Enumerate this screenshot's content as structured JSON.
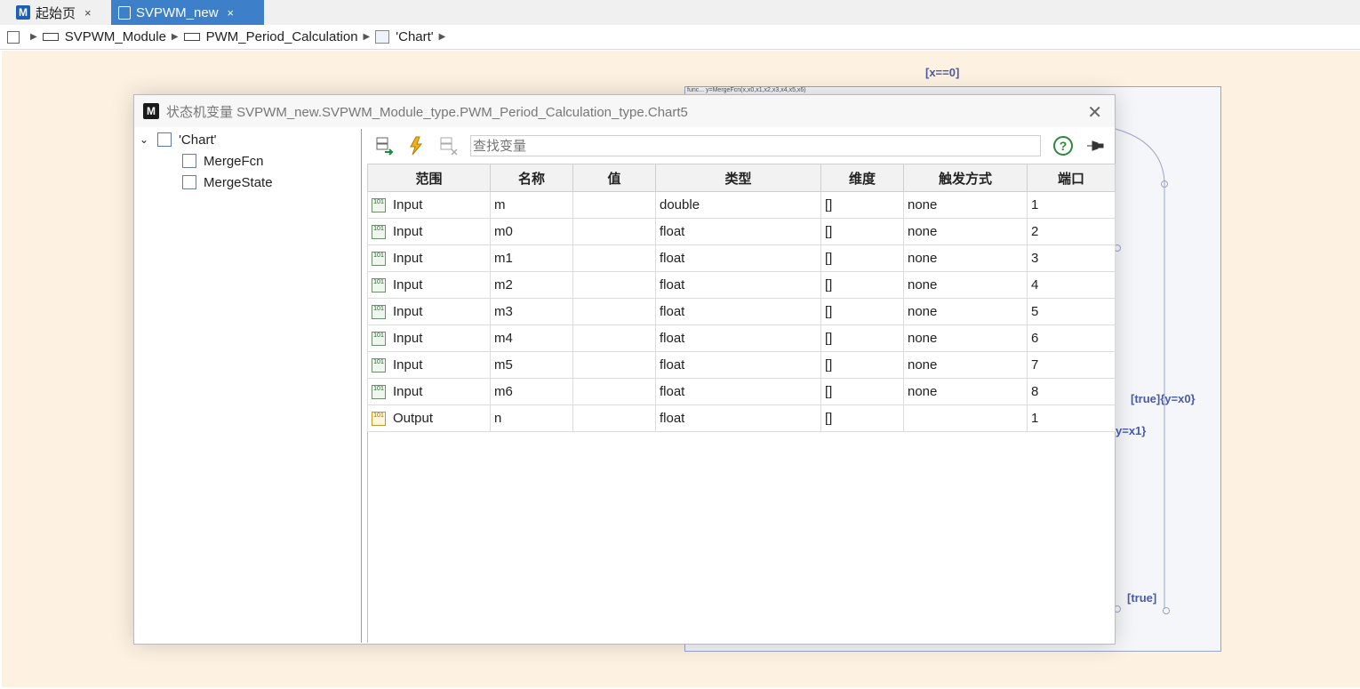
{
  "tabs": [
    {
      "label": "起始页",
      "close": "×"
    },
    {
      "label": "SVPWM_new",
      "close": "×"
    }
  ],
  "breadcrumb": [
    "SVPWM_Module",
    "PWM_Period_Calculation",
    "'Chart'"
  ],
  "canvas": {
    "label_top": "[x==0]",
    "label_state": "func... y=MergeFcn(x,x0,x1,x2,x3,x4,x5,x6)",
    "label_t1": "[true]{y=x0}",
    "label_t2": "y=x1}",
    "label_t3": "[true]"
  },
  "dialog": {
    "title": "状态机变量 SVPWM_new.SVPWM_Module_type.PWM_Period_Calculation_type.Chart5",
    "close": "✕",
    "tree": {
      "root": "'Chart'",
      "children": [
        "MergeFcn",
        "MergeState"
      ]
    },
    "search_placeholder": "查找变量",
    "help": "?",
    "columns": [
      "范围",
      "名称",
      "值",
      "类型",
      "维度",
      "触发方式",
      "端口"
    ],
    "rows": [
      {
        "scope": "Input",
        "name": "m",
        "value": "",
        "type": "double",
        "dim": "[]",
        "trigger": "none",
        "port": "1"
      },
      {
        "scope": "Input",
        "name": "m0",
        "value": "",
        "type": "float",
        "dim": "[]",
        "trigger": "none",
        "port": "2"
      },
      {
        "scope": "Input",
        "name": "m1",
        "value": "",
        "type": "float",
        "dim": "[]",
        "trigger": "none",
        "port": "3"
      },
      {
        "scope": "Input",
        "name": "m2",
        "value": "",
        "type": "float",
        "dim": "[]",
        "trigger": "none",
        "port": "4"
      },
      {
        "scope": "Input",
        "name": "m3",
        "value": "",
        "type": "float",
        "dim": "[]",
        "trigger": "none",
        "port": "5"
      },
      {
        "scope": "Input",
        "name": "m4",
        "value": "",
        "type": "float",
        "dim": "[]",
        "trigger": "none",
        "port": "6"
      },
      {
        "scope": "Input",
        "name": "m5",
        "value": "",
        "type": "float",
        "dim": "[]",
        "trigger": "none",
        "port": "7"
      },
      {
        "scope": "Input",
        "name": "m6",
        "value": "",
        "type": "float",
        "dim": "[]",
        "trigger": "none",
        "port": "8"
      },
      {
        "scope": "Output",
        "name": "n",
        "value": "",
        "type": "float",
        "dim": "[]",
        "trigger": "",
        "port": "1"
      }
    ]
  }
}
